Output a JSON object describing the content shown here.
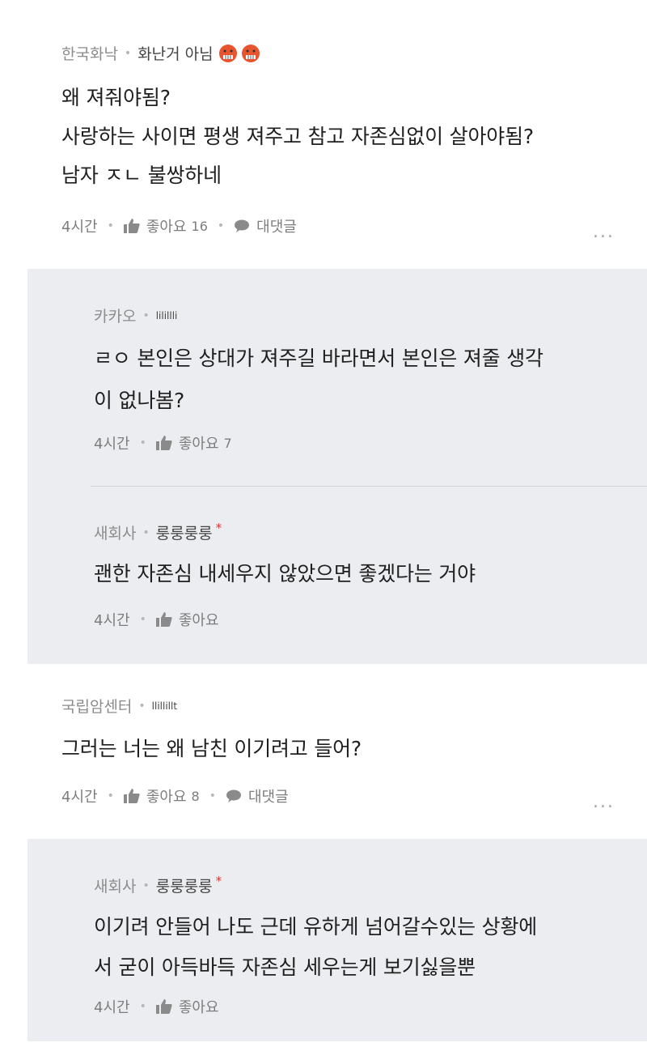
{
  "comments": [
    {
      "author": "한국화낙",
      "nick": "화난거 아님",
      "nick_emojis": [
        "angry-face-icon",
        "angry-face-icon"
      ],
      "lines": [
        "왜 져줘야됨?",
        "사랑하는 사이면 평생 져주고 참고 자존심없이 살아야됨?",
        "남자 ㅈㄴ 불쌍하네"
      ],
      "time": "4시간",
      "like_label": "좋아요",
      "like_count": "16",
      "reply_label": "대댓글",
      "more": "..."
    },
    {
      "author": "국립암센터",
      "nick": "llillillt",
      "lines": [
        "그러는 너는 왜 남친 이기려고 들어?"
      ],
      "time": "4시간",
      "like_label": "좋아요",
      "like_count": "8",
      "reply_label": "대댓글",
      "more": "..."
    }
  ],
  "replies": [
    {
      "author": "카카오",
      "nick": "lilillli",
      "lines": [
        "ㄹㅇ 본인은 상대가 져주길 바라면서 본인은 져줄 생각",
        "이 없나봄?"
      ],
      "time": "4시간",
      "like_label": "좋아요",
      "like_count": "7"
    },
    {
      "author": "새회사",
      "nick": "룽룽룽룽",
      "star": "*",
      "lines": [
        "괜한 자존심 내세우지 않았으면 좋겠다는 거야"
      ],
      "time": "4시간",
      "like_label": "좋아요"
    },
    {
      "author": "새회사",
      "nick": "룽룽룽룽",
      "star": "*",
      "lines": [
        "이기려 안들어 나도 근데 유하게 넘어갈수있는 상황에",
        "서 굳이 아득바득 자존심 세우는게 보기싫을뿐"
      ],
      "time": "4시간",
      "like_label": "좋아요"
    }
  ],
  "colors": {
    "reply_bg": "#ecedf0",
    "star": "#dd3333"
  }
}
